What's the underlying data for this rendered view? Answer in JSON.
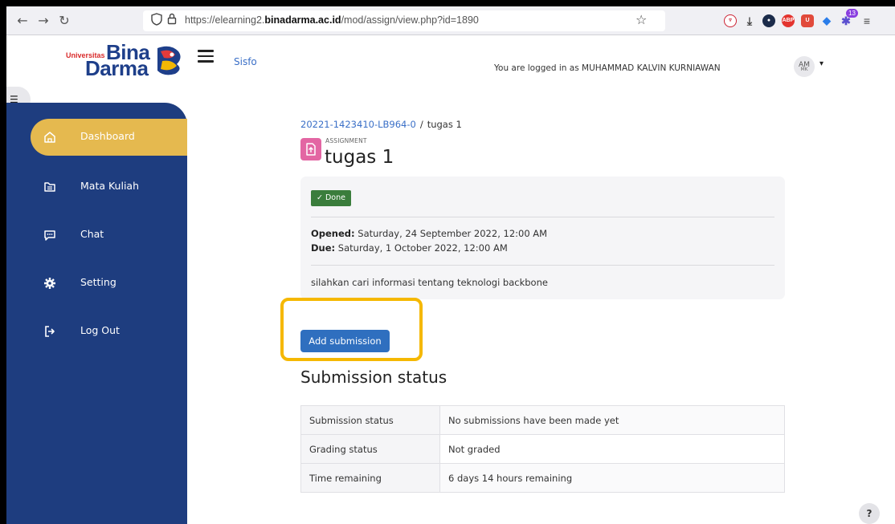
{
  "browser": {
    "back_icon": "arrow-left-icon",
    "forward_icon": "arrow-right-icon",
    "reload_icon": "reload-icon",
    "url_prefix": "https://elearning2.",
    "url_domain": "binadarma.ac.id",
    "url_path": "/mod/assign/view.php?id=1890",
    "extension_badge": "13"
  },
  "header": {
    "logo_small": "Universitas",
    "logo_line1": "Bina",
    "logo_line2": "Darma",
    "nav_link": "Sisfo",
    "login_text": "You are logged in as MUHAMMAD KALVIN KURNIAWAN",
    "avatar_initials": "AM",
    "avatar_sub": "MK"
  },
  "sidebar": {
    "items": [
      {
        "label": "Dashboard",
        "icon": "home-icon",
        "active": true
      },
      {
        "label": "Mata Kuliah",
        "icon": "folder-icon",
        "active": false
      },
      {
        "label": "Chat",
        "icon": "chat-icon",
        "active": false
      },
      {
        "label": "Setting",
        "icon": "gear-icon",
        "active": false
      },
      {
        "label": "Log Out",
        "icon": "logout-icon",
        "active": false
      }
    ]
  },
  "main": {
    "breadcrumb_course": "20221-1423410-LB964-0",
    "breadcrumb_separator": "/",
    "breadcrumb_current": "tugas 1",
    "activity_type": "ASSIGNMENT",
    "title": "tugas 1",
    "done_label": "✓ Done",
    "opened_label": "Opened:",
    "opened_value": " Saturday, 24 September 2022, 12:00 AM",
    "due_label": "Due:",
    "due_value": " Saturday, 1 October 2022, 12:00 AM",
    "description": "silahkan cari informasi tentang teknologi backbone",
    "add_submission_label": "Add submission",
    "status_section_title": "Submission status",
    "status_rows": [
      {
        "label": "Submission status",
        "value": "No submissions have been made yet"
      },
      {
        "label": "Grading status",
        "value": "Not graded"
      },
      {
        "label": "Time remaining",
        "value": "6 days 14 hours remaining"
      }
    ],
    "help_label": "?"
  },
  "colors": {
    "sidebar_bg": "#1e3d7f",
    "sidebar_active": "#e5b94f",
    "button_primary": "#2f6fbf",
    "done_badge": "#3a7d3c",
    "highlight": "#f5b800"
  }
}
